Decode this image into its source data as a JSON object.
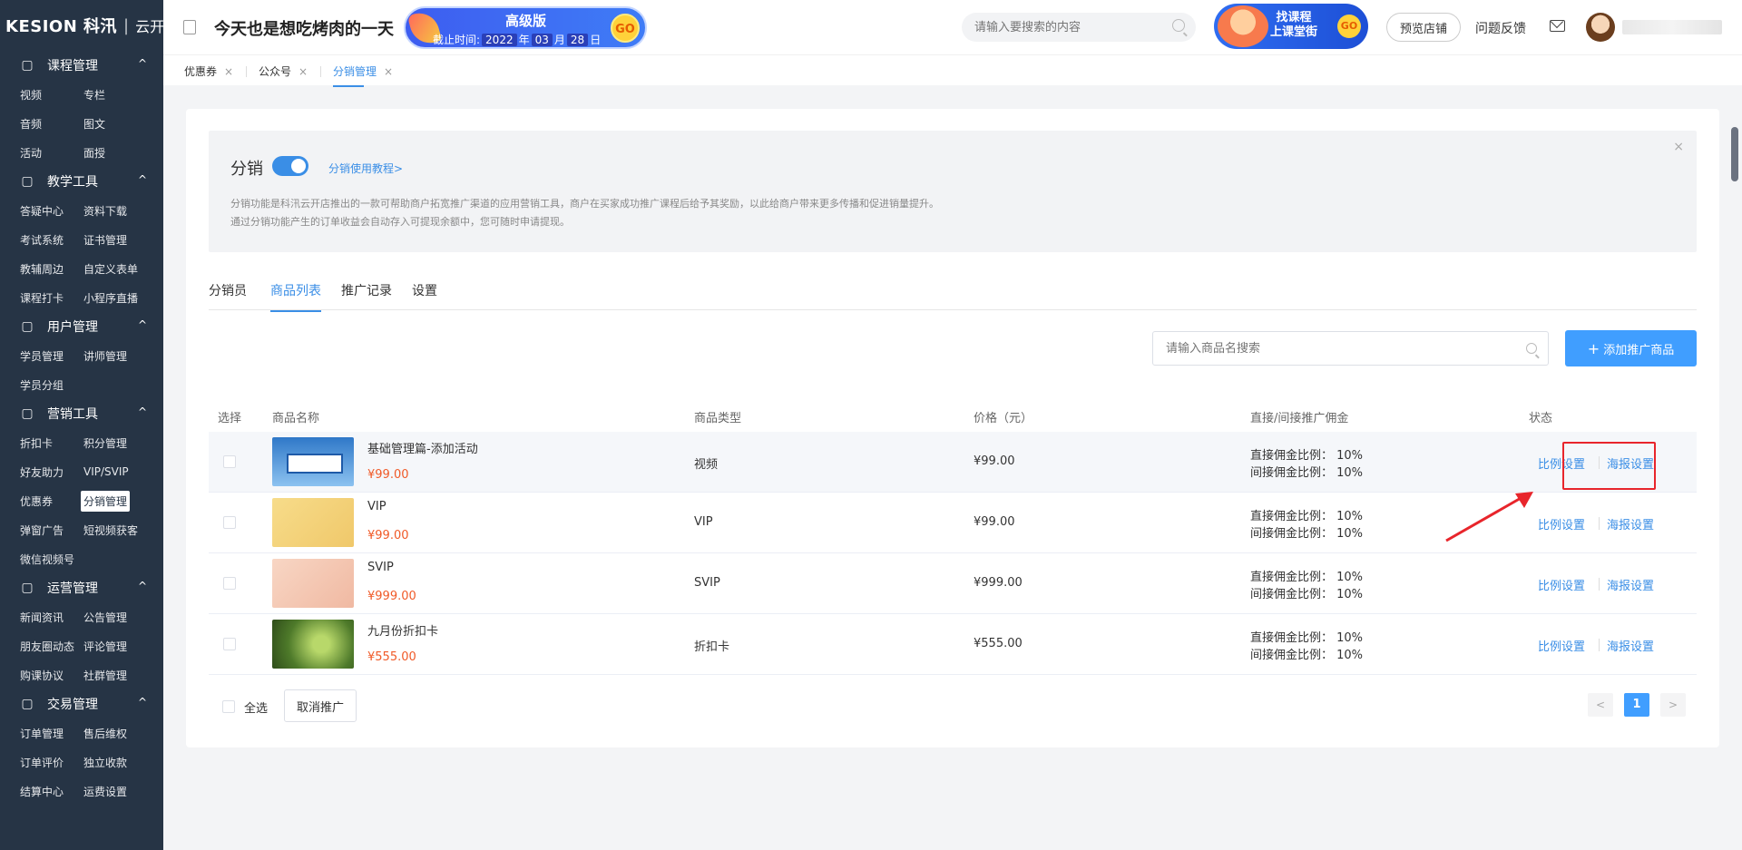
{
  "sidebar": {
    "logo_brand": "KESION 科汛",
    "logo_sep": "|",
    "logo_sub": "云开店",
    "groups": [
      {
        "title": "课程管理",
        "icon": "book-icon",
        "items": [
          "视频",
          "专栏",
          "音频",
          "图文",
          "活动",
          "面授"
        ]
      },
      {
        "title": "教学工具",
        "icon": "cup-icon",
        "items": [
          "答疑中心",
          "资料下载",
          "考试系统",
          "证书管理",
          "教辅周边",
          "自定义表单",
          "课程打卡",
          "小程序直播"
        ]
      },
      {
        "title": "用户管理",
        "icon": "user-circle-icon",
        "items": [
          "学员管理",
          "讲师管理",
          "学员分组"
        ]
      },
      {
        "title": "营销工具",
        "icon": "gift-icon",
        "items": [
          "折扣卡",
          "积分管理",
          "好友助力",
          "VIP/SVIP",
          "优惠券",
          "分销管理",
          "弹窗广告",
          "短视频获客",
          "微信视频号"
        ]
      },
      {
        "title": "运营管理",
        "icon": "layers-icon",
        "items": [
          "新闻资讯",
          "公告管理",
          "朋友圈动态",
          "评论管理",
          "购课协议",
          "社群管理"
        ]
      },
      {
        "title": "交易管理",
        "icon": "yen-icon",
        "items": [
          "订单管理",
          "售后维权",
          "订单评价",
          "独立收款",
          "结算中心",
          "运费设置"
        ]
      }
    ],
    "active_item": "分销管理",
    "chevron": "^"
  },
  "header": {
    "store_name": "今天也是想吃烤肉的一天",
    "promo": {
      "title": "高级版",
      "expire_label": "截止时间:",
      "year": "2022",
      "y": "年",
      "month": "03",
      "m": "月",
      "day": "28",
      "d": "日",
      "go": "GO"
    },
    "search_placeholder": "请输入要搜索的内容",
    "find_course_line1": "找课程",
    "find_course_line2": "上课堂街",
    "find_course_go": "GO",
    "preview_label": "预览店铺",
    "feedback_label": "问题反馈"
  },
  "tabs": [
    {
      "label": "优惠券",
      "close": "×"
    },
    {
      "label": "公众号",
      "close": "×"
    },
    {
      "label": "分销管理",
      "close": "×"
    }
  ],
  "info": {
    "title": "分销",
    "tutorial_link": "分销使用教程>",
    "close": "×",
    "desc1": "分销功能是科汛云开店推出的一款可帮助商户拓宽推广渠道的应用营销工具，商户在买家成功推广课程后给予其奖励，以此给商户带来更多传播和促进销量提升。",
    "desc2": "通过分销功能产生的订单收益会自动存入可提现余额中，您可随时申请提现。",
    "enabled": true
  },
  "subtabs": [
    "分销员",
    "商品列表",
    "推广记录",
    "设置"
  ],
  "goods_search_placeholder": "请输入商品名搜索",
  "add_button_label": "添加推广商品",
  "add_button_plus": "+",
  "table": {
    "headers": {
      "select": "选择",
      "name": "商品名称",
      "type": "商品类型",
      "price": "价格（元）",
      "commission": "直接/间接推广佣金",
      "status": "状态"
    },
    "rows": [
      {
        "name": "基础管理篇-添加活动",
        "sale_price": "¥99.00",
        "type": "视频",
        "price": "¥99.00",
        "direct": "直接佣金比例： 10%",
        "indirect": "间接佣金比例： 10%",
        "op1": "比例设置",
        "op2": "海报设置",
        "thumb": "video-thumb"
      },
      {
        "name": "VIP",
        "sale_price": "¥99.00",
        "type": "VIP",
        "price": "¥99.00",
        "direct": "直接佣金比例： 10%",
        "indirect": "间接佣金比例： 10%",
        "op1": "比例设置",
        "op2": "海报设置",
        "thumb": "vip-thumb"
      },
      {
        "name": "SVIP",
        "sale_price": "¥999.00",
        "type": "SVIP",
        "price": "¥999.00",
        "direct": "直接佣金比例： 10%",
        "indirect": "间接佣金比例： 10%",
        "op1": "比例设置",
        "op2": "海报设置",
        "thumb": "svip-thumb"
      },
      {
        "name": "九月份折扣卡",
        "sale_price": "¥555.00",
        "type": "折扣卡",
        "price": "¥555.00",
        "direct": "直接佣金比例： 10%",
        "indirect": "间接佣金比例： 10%",
        "op1": "比例设置",
        "op2": "海报设置",
        "thumb": "bird-thumb"
      }
    ]
  },
  "footer": {
    "select_all": "全选",
    "cancel_label": "取消推广",
    "page": "1",
    "prev": "<",
    "next": ">"
  },
  "colors": {
    "accent": "#409eff",
    "sidebar_bg": "#263445",
    "price_red": "#f05a28",
    "annotation_red": "#e8252b"
  }
}
